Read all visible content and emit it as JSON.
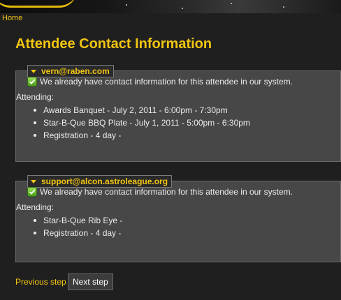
{
  "breadcrumb": {
    "home": "Home"
  },
  "page": {
    "title": "Attendee Contact Information"
  },
  "attendees": [
    {
      "email": "vern@raben.com",
      "message": "We already have contact information for this attendee in our system.",
      "attending_label": "Attending:",
      "events": [
        "Awards Banquet - July 2, 2011 - 6:00pm - 7:30pm",
        "Star-B-Que BBQ Plate - July 1, 2011 - 5:00pm - 6:30pm",
        "Registration - 4 day -"
      ]
    },
    {
      "email": "support@alcon.astroleague.org",
      "message": "We already have contact information for this attendee in our system.",
      "attending_label": "Attending:",
      "events": [
        "Star-B-Que Rib Eye -",
        "Registration - 4 day -"
      ]
    }
  ],
  "nav": {
    "previous": "Previous step",
    "next": "Next step"
  },
  "colors": {
    "accent": "#f2c511",
    "background": "#1f1f1f",
    "panel": "#474747",
    "check": "#6cbf2e"
  }
}
